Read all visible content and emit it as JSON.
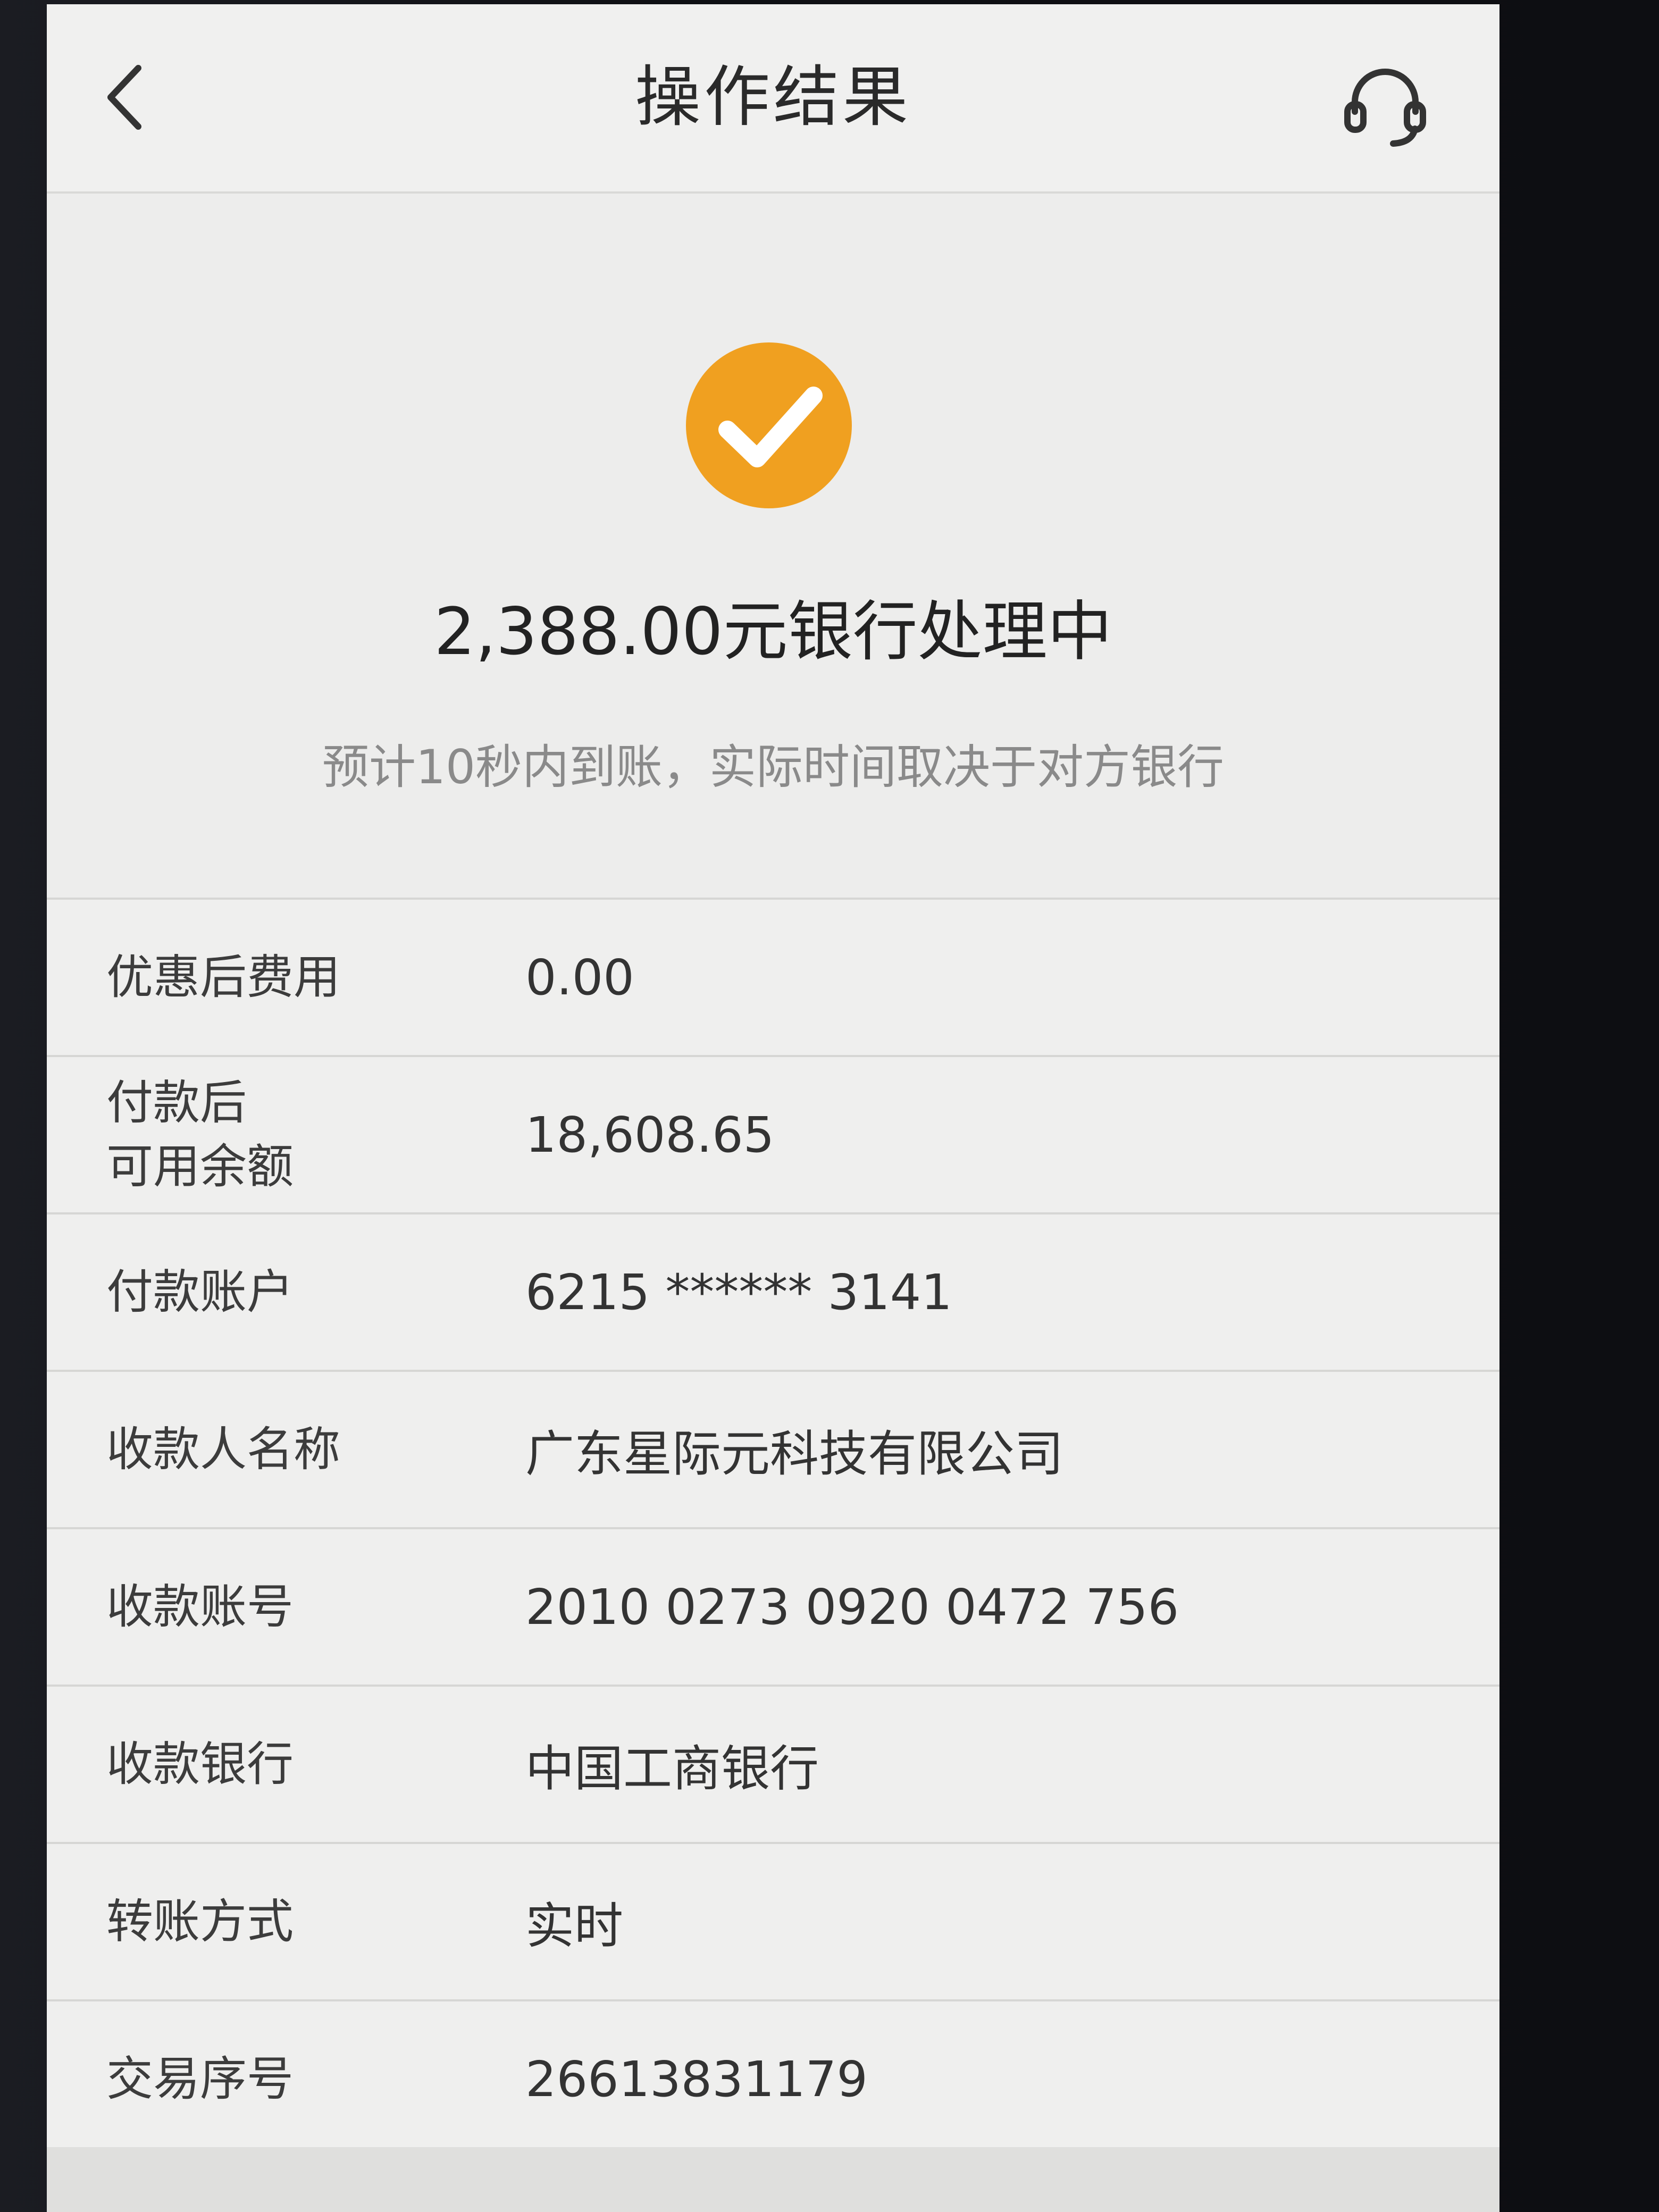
{
  "nav": {
    "title": "操作结果",
    "back_icon": "chevron-left-icon",
    "service_icon": "headset-icon"
  },
  "result": {
    "status_icon": "check-circle-icon",
    "accent_color": "#F0A020",
    "title": "2,388.00元银行处理中",
    "subtitle": "预计10秒内到账，实际时间取决于对方银行"
  },
  "details": [
    {
      "label": "优惠后费用",
      "value": "0.00"
    },
    {
      "label": "付款后\n可用余额",
      "value": "18,608.65"
    },
    {
      "label": "付款账户",
      "value": "6215 ****** 3141"
    },
    {
      "label": "收款人名称",
      "value": "广东星际元科技有限公司"
    },
    {
      "label": "收款账号",
      "value": "2010 0273 0920 0472 756"
    },
    {
      "label": "收款银行",
      "value": "中国工商银行"
    },
    {
      "label": "转账方式",
      "value": "实时"
    },
    {
      "label": "交易序号",
      "value": "26613831179"
    }
  ]
}
